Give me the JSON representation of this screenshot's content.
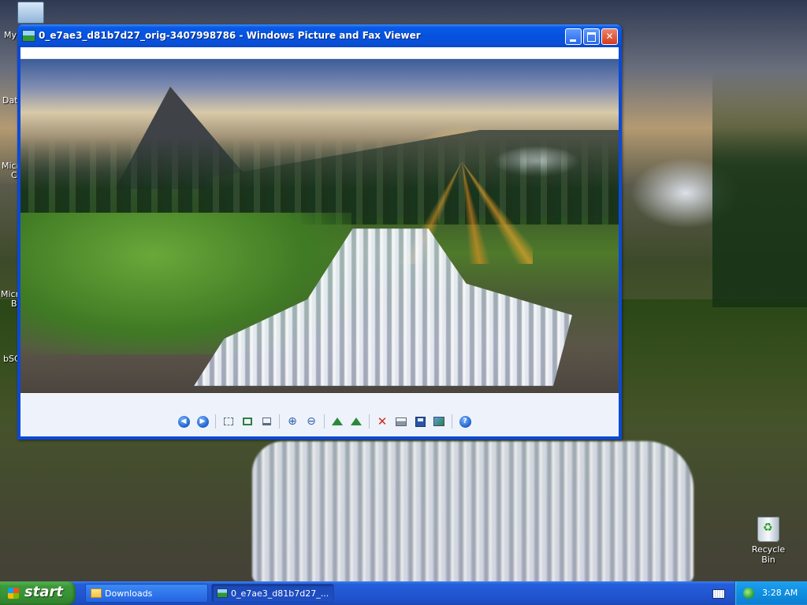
{
  "desktop": {
    "icons": {
      "my_computer_label": "My",
      "icon2_label": "Dat",
      "icon3_label": "Micr",
      "icon3b_label": "C",
      "icon4_label": "Micro",
      "icon4b_label": "B",
      "icon5_label": "bSC",
      "recycle_bin_label": "Recycle Bin"
    }
  },
  "window": {
    "title": "0_e7ae3_d81b7d27_orig-3407998786 - Windows Picture and Fax Viewer",
    "app_icon": "picture-viewer-icon",
    "controls": [
      "minimize-icon",
      "maximize-icon",
      "close-icon"
    ]
  },
  "toolbar": {
    "buttons": [
      {
        "icon": "previous-image-icon",
        "glyph": "⏮"
      },
      {
        "icon": "next-image-icon",
        "glyph": "⏭"
      },
      {
        "icon": "best-fit-icon"
      },
      {
        "icon": "actual-size-icon"
      },
      {
        "icon": "slideshow-icon"
      },
      {
        "icon": "zoom-in-icon",
        "glyph": "🔍"
      },
      {
        "icon": "zoom-out-icon",
        "glyph": "🔍"
      },
      {
        "icon": "rotate-clockwise-icon"
      },
      {
        "icon": "rotate-counterclockwise-icon"
      },
      {
        "icon": "delete-icon",
        "glyph": "✕"
      },
      {
        "icon": "print-icon"
      },
      {
        "icon": "save-icon"
      },
      {
        "icon": "edit-image-icon"
      },
      {
        "icon": "help-icon",
        "glyph": "?"
      }
    ]
  },
  "taskbar": {
    "start_label": "start",
    "tasks": [
      {
        "label": "Downloads",
        "icon": "folder-icon"
      },
      {
        "label": "0_e7ae3_d81b7d27_...",
        "icon": "picture-viewer-icon"
      }
    ],
    "tray": {
      "clock": "3:28 AM",
      "icons": [
        "keyboard-layout-icon",
        "network-icon"
      ]
    }
  }
}
